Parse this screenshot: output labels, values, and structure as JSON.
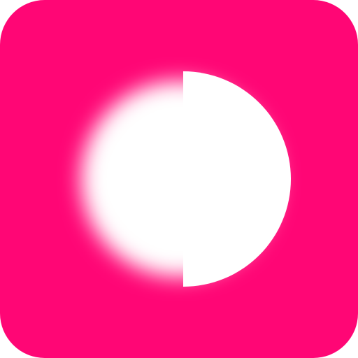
{
  "icon": {
    "name": "crescent-glow-app-icon",
    "background_color": "#FF0675",
    "glyph_color": "#FFFFFF"
  }
}
